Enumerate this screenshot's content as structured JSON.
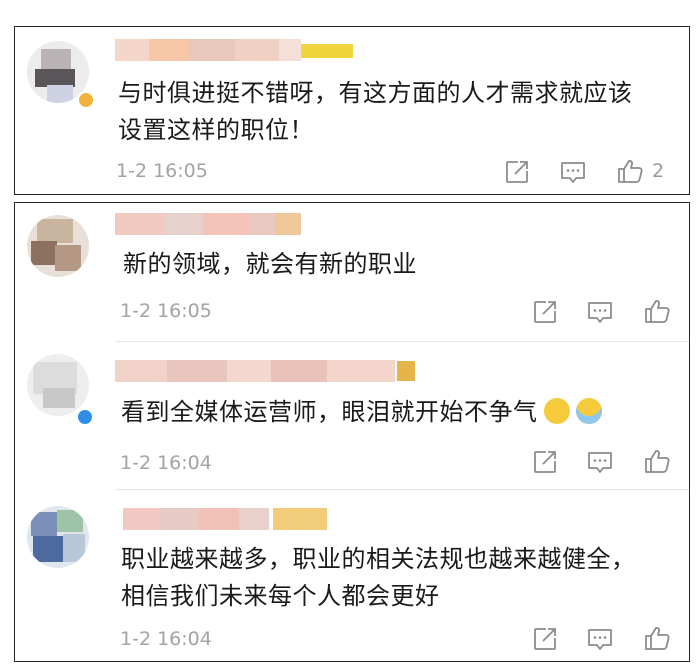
{
  "comments": [
    {
      "text_lines": [
        "与时俱进挺不错呀，有这方面的人才需求就应该",
        "设置这样的职位！"
      ],
      "time": "1-2 16:05",
      "like_count": "2"
    },
    {
      "text_lines": [
        "新的领域，就会有新的职业"
      ],
      "time": "1-2 16:05",
      "like_count": ""
    },
    {
      "text_lines": [
        "看到全媒体运营师，眼泪就开始不争气"
      ],
      "time": "1-2 16:04",
      "like_count": ""
    },
    {
      "text_lines": [
        "职业越来越多，职业的相关法规也越来越健全，",
        "相信我们未来每个人都会更好"
      ],
      "time": "1-2 16:04",
      "like_count": ""
    }
  ],
  "icons": {
    "share": "share-icon",
    "comment": "comment-icon",
    "like": "thumbs-up-icon"
  },
  "colors": {
    "text": "#1a1a1a",
    "meta": "#a3a3a3",
    "icon": "#8c8c8c",
    "verified_badge": "#2f8fe8"
  }
}
